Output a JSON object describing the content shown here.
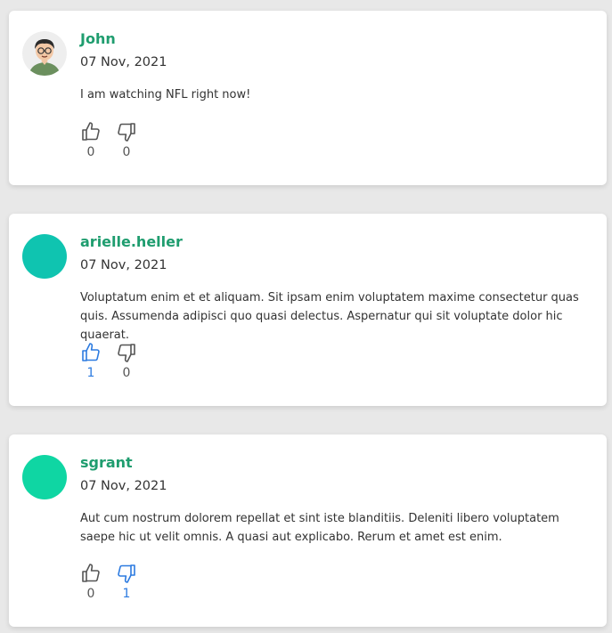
{
  "colors": {
    "username": "#1f9d6f",
    "active_vote": "#2d7be0",
    "inactive_vote": "#555555",
    "avatar_2": "#0fc4b0",
    "avatar_3": "#0fd6a3"
  },
  "comments": [
    {
      "username": "John",
      "date": "07 Nov, 2021",
      "text": "I am watching NFL right now!",
      "avatar": "cartoon-man-avatar",
      "likes": "0",
      "dislikes": "0",
      "liked": false,
      "disliked": false
    },
    {
      "username": "arielle.heller",
      "date": "07 Nov, 2021",
      "text": "Voluptatum enim et et aliquam. Sit ipsam enim voluptatem maxime consectetur quas quis. Assumenda adipisci quo quasi delectus. Aspernatur qui sit voluptate dolor hic quaerat.",
      "avatar": "teal-circle-avatar",
      "likes": "1",
      "dislikes": "0",
      "liked": true,
      "disliked": false
    },
    {
      "username": "sgrant",
      "date": "07 Nov, 2021",
      "text": "Aut cum nostrum dolorem repellat et sint iste blanditiis. Deleniti libero voluptatem saepe hic ut velit omnis. A quasi aut explicabo. Rerum et amet est enim.",
      "avatar": "green-circle-avatar",
      "likes": "0",
      "dislikes": "1",
      "liked": false,
      "disliked": true
    }
  ]
}
